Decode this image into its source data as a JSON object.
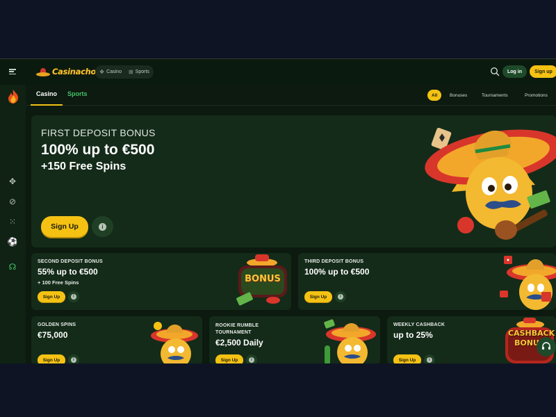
{
  "brand": {
    "name": "Casinacho"
  },
  "topnav": {
    "casino": "Casino",
    "sports": "Sports"
  },
  "auth": {
    "login": "Log in",
    "signup": "Sign up"
  },
  "subnav": {
    "tabs": [
      "Casino",
      "Sports"
    ],
    "filters": [
      "All",
      "Bonuses",
      "Tournaments",
      "Promotions"
    ]
  },
  "hero": {
    "kicker": "FIRST DEPOSIT BONUS",
    "title": "100% up to €500",
    "subtitle": "+150 Free Spins",
    "cta": "Sign Up"
  },
  "cards": [
    {
      "title": "SECOND DEPOSIT BONUS",
      "amount": "55% up to €500",
      "extra": "+ 100 Free Spins",
      "cta": "Sign Up",
      "badge": "BONUS"
    },
    {
      "title": "THIRD DEPOSIT BONUS",
      "amount": "100% up to €500",
      "cta": "Sign Up"
    },
    {
      "title": "GOLDEN SPINS",
      "amount": "€75,000",
      "cta": "Sign Up"
    },
    {
      "title": "ROOKIE RUMBLE TOURNAMENT",
      "amount": "€2,500 Daily",
      "cta": "Sign Up"
    },
    {
      "title": "WEEKLY CASHBACK",
      "amount": "up to 25%",
      "cta": "Sign Up",
      "badge": "CASHBACK BONUS"
    }
  ],
  "info_glyph": "i",
  "colors": {
    "accent": "#f5c214",
    "background": "#0c1a0f",
    "card": "#142b19",
    "login_bg": "#1e4a2a",
    "tab_green": "#46c169"
  }
}
